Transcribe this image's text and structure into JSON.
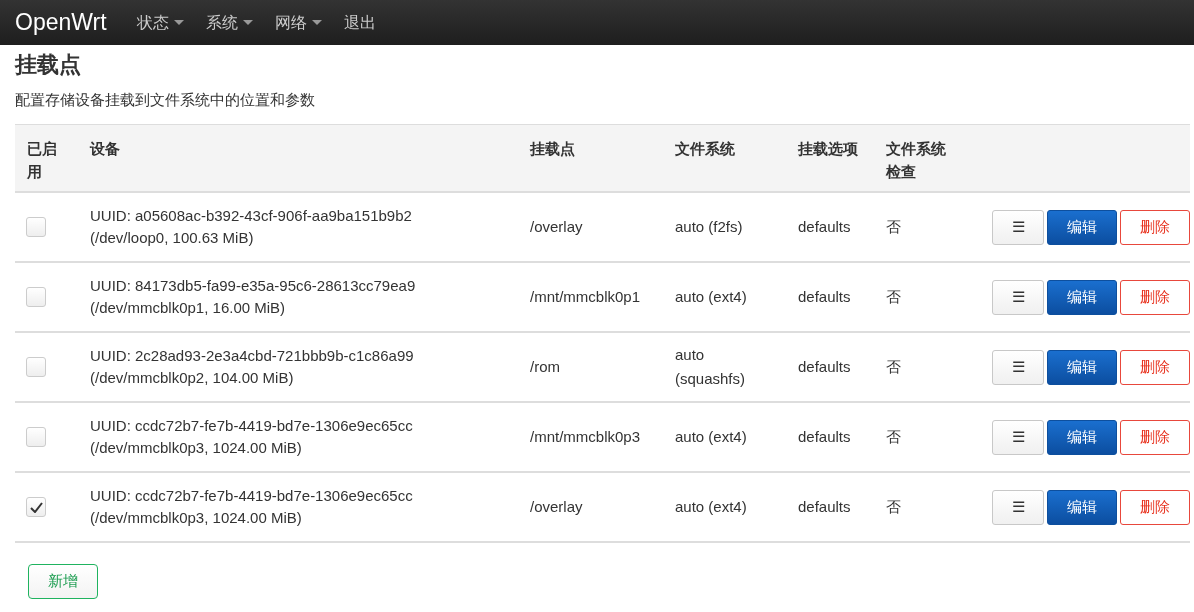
{
  "navbar": {
    "brand": "OpenWrt",
    "menu": [
      {
        "label": "状态",
        "dropdown": true
      },
      {
        "label": "系统",
        "dropdown": true
      },
      {
        "label": "网络",
        "dropdown": true
      },
      {
        "label": "退出",
        "dropdown": false
      }
    ]
  },
  "page": {
    "title": "挂载点",
    "description": "配置存储设备挂载到文件系统中的位置和参数"
  },
  "table": {
    "columns": [
      "已启用",
      "设备",
      "挂载点",
      "文件系统",
      "挂载选项",
      "文件系统检查"
    ],
    "rows": [
      {
        "enabled": false,
        "device": "UUID: a05608ac-b392-43cf-906f-aa9ba151b9b2",
        "device_detail": "(/dev/loop0, 100.63 MiB)",
        "mount_point": "/overlay",
        "filesystem": "auto (f2fs)",
        "options": "defaults",
        "fsck": "否",
        "actions": [
          "☰",
          "编辑",
          "删除"
        ]
      },
      {
        "enabled": false,
        "device": "UUID: 84173db5-fa99-e35a-95c6-28613cc79ea9",
        "device_detail": "(/dev/mmcblk0p1, 16.00 MiB)",
        "mount_point": "/mnt/mmcblk0p1",
        "filesystem": "auto (ext4)",
        "options": "defaults",
        "fsck": "否",
        "actions": [
          "☰",
          "编辑",
          "删除"
        ]
      },
      {
        "enabled": false,
        "device": "UUID: 2c28ad93-2e3a4cbd-721bbb9b-c1c86a99",
        "device_detail": "(/dev/mmcblk0p2, 104.00 MiB)",
        "mount_point": "/rom",
        "filesystem": "auto (squashfs)",
        "options": "defaults",
        "fsck": "否",
        "actions": [
          "☰",
          "编辑",
          "删除"
        ]
      },
      {
        "enabled": false,
        "device": "UUID: ccdc72b7-fe7b-4419-bd7e-1306e9ec65cc",
        "device_detail": "(/dev/mmcblk0p3, 1024.00 MiB)",
        "mount_point": "/mnt/mmcblk0p3",
        "filesystem": "auto (ext4)",
        "options": "defaults",
        "fsck": "否",
        "actions": [
          "☰",
          "编辑",
          "删除"
        ]
      },
      {
        "enabled": true,
        "device": "UUID: ccdc72b7-fe7b-4419-bd7e-1306e9ec65cc",
        "device_detail": "(/dev/mmcblk0p3, 1024.00 MiB)",
        "mount_point": "/overlay",
        "filesystem": "auto (ext4)",
        "options": "defaults",
        "fsck": "否",
        "actions": [
          "☰",
          "编辑",
          "删除"
        ]
      }
    ]
  },
  "add_button": "新增"
}
